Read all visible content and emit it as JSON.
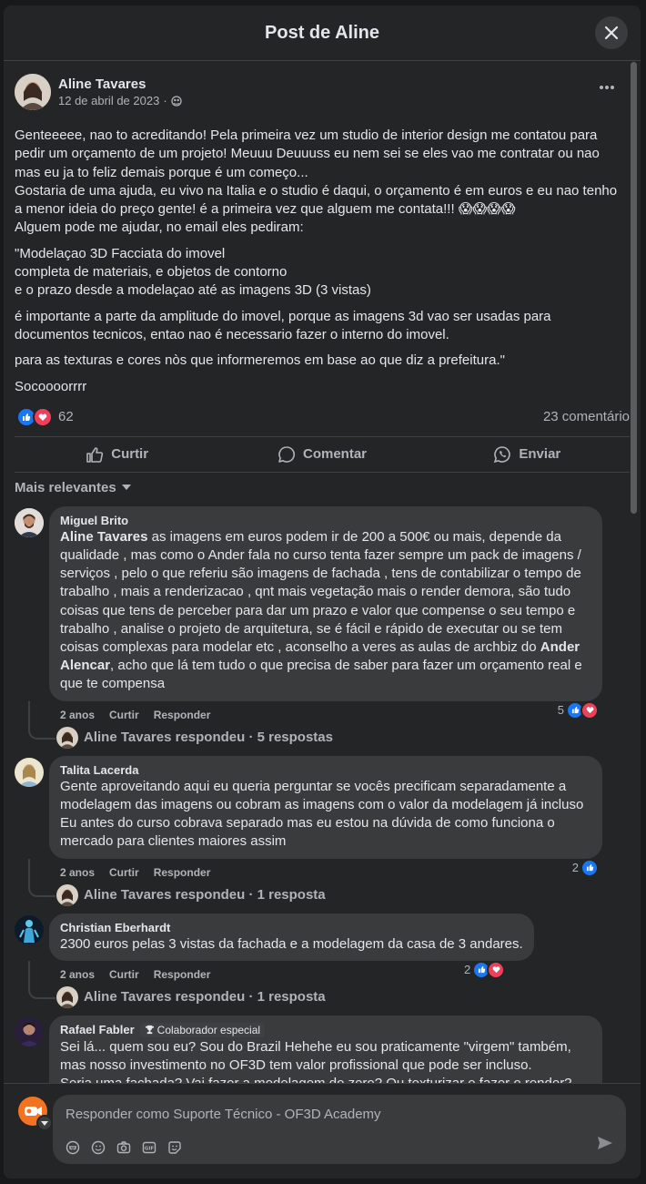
{
  "modal": {
    "title": "Post de Aline"
  },
  "post": {
    "author": "Aline Tavares",
    "date": "12 de abril de 2023",
    "audience_icon": "friends-icon",
    "paragraphs": [
      "Genteeeee, nao to acreditando! Pela primeira vez um studio de interior design me contatou para pedir um orçamento de um projeto! Meuuu Deuuuss eu nem sei se eles vao me contratar ou nao mas eu ja to feliz demais porque é um começo...\nGostaria de uma ajuda, eu vivo na Italia e o studio é daqui, o orçamento é em euros e eu nao tenho a menor ideia do preço gente! é a primeira vez que alguem me contata!!! 😱😱😱😱\nAlguem pode me ajudar, no email eles pediram:",
      "\"Modelaçao 3D Facciata do imovel\ncompleta de materiais, e objetos de contorno\ne o prazo desde a modelaçao até as imagens 3D (3 vistas)",
      "é importante a parte da amplitude do imovel, porque as imagens 3d vao ser usadas para documentos tecnicos, entao nao é necessario fazer o interno do imovel.",
      "para as texturas e cores nòs que informeremos em base ao que diz a prefeitura.\"",
      "Socoooorrrr"
    ],
    "reaction_count": "62",
    "comment_count": "23 comentário",
    "actions": {
      "like": "Curtir",
      "comment": "Comentar",
      "send": "Enviar"
    }
  },
  "sort_label": "Mais relevantes",
  "comments": [
    {
      "author": "Miguel Brito",
      "mention1": "Aline Tavares",
      "text1": " as imagens em euros podem ir de 200 a 500€ ou mais, depende da qualidade , mas como o Ander fala no curso tenta fazer sempre um pack de imagens / serviços , pelo o que referiu são imagens de fachada , tens de contabilizar o tempo de trabalho , mais a renderizacao , qnt mais vegetação mais o render demora, são tudo coisas que tens de perceber para dar um prazo e valor que compense o seu tempo e trabalho , analise o projeto de arquitetura, se é fácil e rápido de executar ou se tem coisas complexas para modelar etc , aconselho a veres as aulas de archbiz do ",
      "mention2": "Ander Alencar",
      "text2": ", acho que lá tem tudo o que precisa de saber para fazer um orçamento real e que te compensa",
      "time": "2 anos",
      "like": "Curtir",
      "reply": "Responder",
      "reactions": "5",
      "replies": "Aline Tavares respondeu · 5 respostas"
    },
    {
      "author": "Talita Lacerda",
      "text": "Gente aproveitando aqui eu queria perguntar se vocês precificam separadamente a modelagem das imagens ou cobram as imagens com o valor da modelagem já incluso\nEu antes do curso cobrava separado mas eu estou na dúvida de como funciona o mercado para clientes maiores assim",
      "time": "2 anos",
      "like": "Curtir",
      "reply": "Responder",
      "reactions": "2",
      "replies": "Aline Tavares respondeu · 1 resposta"
    },
    {
      "author": "Christian Eberhardt",
      "text": "2300 euros pelas 3 vistas da fachada e a modelagem da casa de 3 andares.",
      "time": "2 anos",
      "like": "Curtir",
      "reply": "Responder",
      "reactions": "2",
      "replies": "Aline Tavares respondeu · 1 resposta"
    },
    {
      "author": "Rafael Fabler",
      "badge": "Colaborador especial",
      "text": "Sei lá... quem sou eu? Sou do Brazil Hehehe eu sou praticamente \"virgem\" também, mas nosso investimento no OF3D tem valor profissional que pode ser incluso.\nSeria uma fachada? Vai fazer a modelagem do zero? Ou texturizar e fazer o render?\nIsso conta, boto fé, em todo o tempo e serviço."
    }
  ],
  "composer": {
    "placeholder": "Responder como Suporte Técnico - OF3D Academy"
  },
  "colors": {
    "accent": "#1877f2",
    "love": "#f33e58",
    "background": "#242526",
    "bubble": "#3a3b3c"
  }
}
